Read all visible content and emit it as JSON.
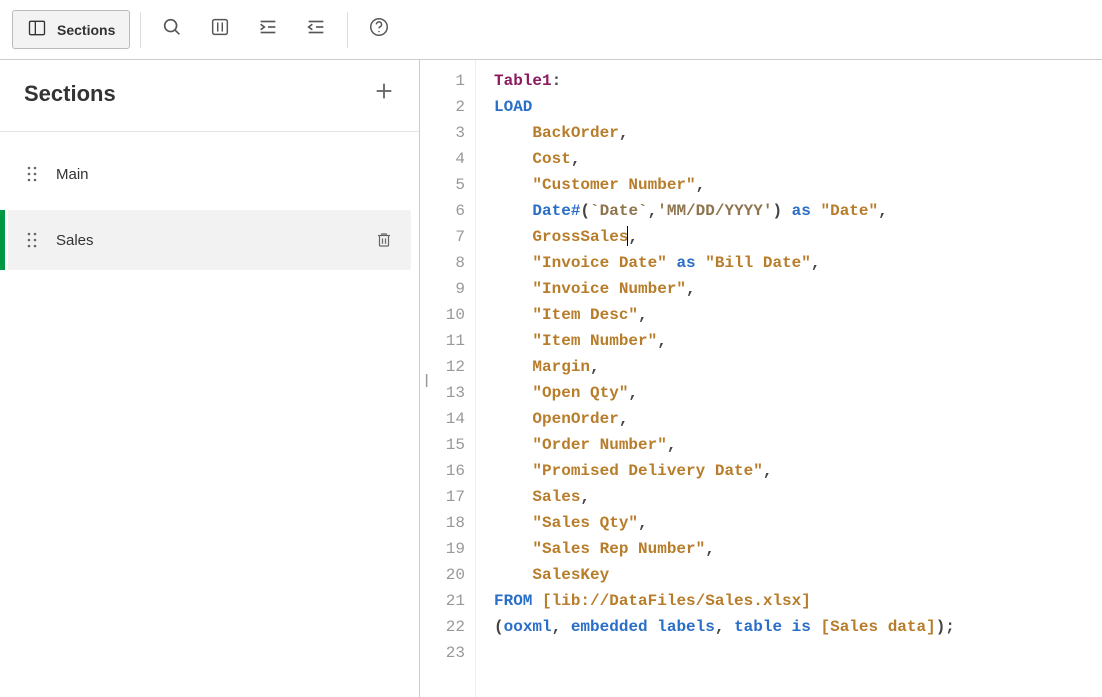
{
  "toolbar": {
    "sections_label": "Sections"
  },
  "sidebar": {
    "title": "Sections",
    "items": [
      {
        "label": "Main",
        "active": false
      },
      {
        "label": "Sales",
        "active": true
      }
    ]
  },
  "editor": {
    "lines": [
      [
        {
          "c": "tok-table",
          "t": "Table1"
        },
        {
          "c": "tok-plain",
          "t": ":"
        }
      ],
      [
        {
          "c": "tok-kw",
          "t": "LOAD"
        }
      ],
      [
        {
          "c": "",
          "t": "    "
        },
        {
          "c": "tok-field",
          "t": "BackOrder"
        },
        {
          "c": "tok-plain",
          "t": ","
        }
      ],
      [
        {
          "c": "",
          "t": "    "
        },
        {
          "c": "tok-field",
          "t": "Cost"
        },
        {
          "c": "tok-plain",
          "t": ","
        }
      ],
      [
        {
          "c": "",
          "t": "    "
        },
        {
          "c": "tok-field",
          "t": "\"Customer Number\""
        },
        {
          "c": "tok-plain",
          "t": ","
        }
      ],
      [
        {
          "c": "",
          "t": "    "
        },
        {
          "c": "tok-func",
          "t": "Date#"
        },
        {
          "c": "tok-plain",
          "t": "("
        },
        {
          "c": "tok-backtick",
          "t": "`Date`"
        },
        {
          "c": "tok-plain",
          "t": ","
        },
        {
          "c": "tok-string",
          "t": "'MM/DD/YYYY'"
        },
        {
          "c": "tok-plain",
          "t": ") "
        },
        {
          "c": "tok-kw",
          "t": "as"
        },
        {
          "c": "tok-plain",
          "t": " "
        },
        {
          "c": "tok-field",
          "t": "\"Date\""
        },
        {
          "c": "tok-plain",
          "t": ","
        }
      ],
      [
        {
          "c": "",
          "t": "    "
        },
        {
          "c": "tok-field",
          "t": "GrossSales"
        },
        {
          "cursor": true
        },
        {
          "c": "tok-plain",
          "t": ","
        }
      ],
      [
        {
          "c": "",
          "t": "    "
        },
        {
          "c": "tok-field",
          "t": "\"Invoice Date\""
        },
        {
          "c": "tok-plain",
          "t": " "
        },
        {
          "c": "tok-kw",
          "t": "as"
        },
        {
          "c": "tok-plain",
          "t": " "
        },
        {
          "c": "tok-field",
          "t": "\"Bill Date\""
        },
        {
          "c": "tok-plain",
          "t": ","
        }
      ],
      [
        {
          "c": "",
          "t": "    "
        },
        {
          "c": "tok-field",
          "t": "\"Invoice Number\""
        },
        {
          "c": "tok-plain",
          "t": ","
        }
      ],
      [
        {
          "c": "",
          "t": "    "
        },
        {
          "c": "tok-field",
          "t": "\"Item Desc\""
        },
        {
          "c": "tok-plain",
          "t": ","
        }
      ],
      [
        {
          "c": "",
          "t": "    "
        },
        {
          "c": "tok-field",
          "t": "\"Item Number\""
        },
        {
          "c": "tok-plain",
          "t": ","
        }
      ],
      [
        {
          "c": "",
          "t": "    "
        },
        {
          "c": "tok-field",
          "t": "Margin"
        },
        {
          "c": "tok-plain",
          "t": ","
        }
      ],
      [
        {
          "c": "",
          "t": "    "
        },
        {
          "c": "tok-field",
          "t": "\"Open Qty\""
        },
        {
          "c": "tok-plain",
          "t": ","
        }
      ],
      [
        {
          "c": "",
          "t": "    "
        },
        {
          "c": "tok-field",
          "t": "OpenOrder"
        },
        {
          "c": "tok-plain",
          "t": ","
        }
      ],
      [
        {
          "c": "",
          "t": "    "
        },
        {
          "c": "tok-field",
          "t": "\"Order Number\""
        },
        {
          "c": "tok-plain",
          "t": ","
        }
      ],
      [
        {
          "c": "",
          "t": "    "
        },
        {
          "c": "tok-field",
          "t": "\"Promised Delivery Date\""
        },
        {
          "c": "tok-plain",
          "t": ","
        }
      ],
      [
        {
          "c": "",
          "t": "    "
        },
        {
          "c": "tok-field",
          "t": "Sales"
        },
        {
          "c": "tok-plain",
          "t": ","
        }
      ],
      [
        {
          "c": "",
          "t": "    "
        },
        {
          "c": "tok-field",
          "t": "\"Sales Qty\""
        },
        {
          "c": "tok-plain",
          "t": ","
        }
      ],
      [
        {
          "c": "",
          "t": "    "
        },
        {
          "c": "tok-field",
          "t": "\"Sales Rep Number\""
        },
        {
          "c": "tok-plain",
          "t": ","
        }
      ],
      [
        {
          "c": "",
          "t": "    "
        },
        {
          "c": "tok-field",
          "t": "SalesKey"
        }
      ],
      [
        {
          "c": "tok-kw",
          "t": "FROM"
        },
        {
          "c": "tok-plain",
          "t": " "
        },
        {
          "c": "tok-field",
          "t": "[lib://DataFiles/Sales.xlsx]"
        }
      ],
      [
        {
          "c": "tok-plain",
          "t": "("
        },
        {
          "c": "tok-kw",
          "t": "ooxml"
        },
        {
          "c": "tok-plain",
          "t": ", "
        },
        {
          "c": "tok-kw",
          "t": "embedded labels"
        },
        {
          "c": "tok-plain",
          "t": ", "
        },
        {
          "c": "tok-kw",
          "t": "table is"
        },
        {
          "c": "tok-plain",
          "t": " "
        },
        {
          "c": "tok-field",
          "t": "[Sales data]"
        },
        {
          "c": "tok-plain",
          "t": ");"
        }
      ],
      [
        {
          "c": "",
          "t": ""
        }
      ]
    ]
  }
}
